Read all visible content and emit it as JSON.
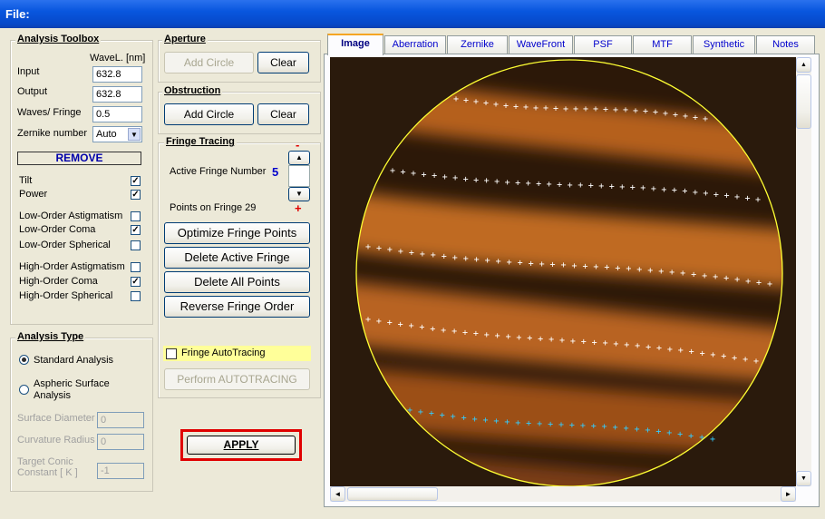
{
  "window": {
    "title": "File:"
  },
  "toolbox": {
    "title": "Analysis Toolbox",
    "wavel_header": "WaveL. [nm]",
    "input_label": "Input",
    "input_value": "632.8",
    "output_label": "Output",
    "output_value": "632.8",
    "wpf_label": "Waves/ Fringe",
    "wpf_value": "0.5",
    "zernike_label": "Zernike number",
    "zernike_value": "Auto",
    "remove_label": "REMOVE",
    "terms": [
      {
        "label": "Tilt",
        "checked": true
      },
      {
        "label": "Power",
        "checked": true
      },
      {
        "label": "Low-Order  Astigmatism",
        "checked": false
      },
      {
        "label": "Low-Order  Coma",
        "checked": true
      },
      {
        "label": "Low-Order  Spherical",
        "checked": false
      },
      {
        "label": "High-Order  Astigmatism",
        "checked": false
      },
      {
        "label": "High-Order  Coma",
        "checked": true
      },
      {
        "label": "High-Order  Spherical",
        "checked": false
      }
    ]
  },
  "analysis_type": {
    "title": "Analysis Type",
    "standard": "Standard  Analysis",
    "aspheric_1": "Aspheric  Surface",
    "aspheric_2": "Analysis",
    "surface_diameter_label": "Surface Diameter",
    "surface_diameter_value": "0",
    "curvature_radius_label": "Curvature Radius",
    "curvature_radius_value": "0",
    "target_conic_label_1": "Target Conic",
    "target_conic_label_2": "Constant [ K ]",
    "target_conic_value": "-1"
  },
  "aperture": {
    "title": "Aperture",
    "add": "Add Circle",
    "clear": "Clear"
  },
  "obstruction": {
    "title": "Obstruction",
    "add": "Add Circle",
    "clear": "Clear"
  },
  "fringe": {
    "title": "Fringe Tracing",
    "minus": "-",
    "plus": "+",
    "active_label": "Active Fringe Number",
    "active_value": "5",
    "points_label": "Points on  Fringe 29",
    "optimize": "Optimize Fringe Points",
    "delete_active": "Delete Active Fringe",
    "delete_all": "Delete  All  Points",
    "reverse": "Reverse  Fringe Order",
    "autotracing": "Fringe AutoTracing",
    "perform": "Perform  AUTOTRACING"
  },
  "apply": "APPLY",
  "tabs": [
    "Image",
    "Aberration",
    "Zernike",
    "WaveFront",
    "PSF",
    "MTF",
    "Synthetic",
    "Notes"
  ],
  "scroll": {
    "up": "▲",
    "down": "▼",
    "left": "◄",
    "right": "►"
  },
  "colors": {
    "circle": "#ffff33",
    "points": "#ffffff",
    "active_points": "#33ccff",
    "apply_border": "#e00000"
  }
}
